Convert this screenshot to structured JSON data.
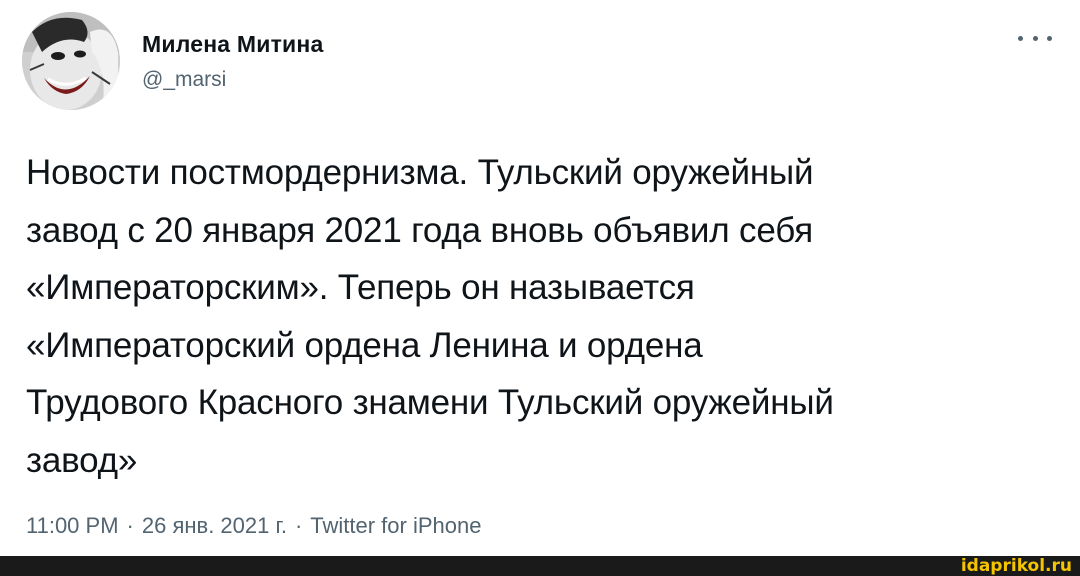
{
  "author": {
    "name": "Милена Митина",
    "handle": "@_marsi"
  },
  "tweet": {
    "text": "Новости постмордернизма. Тульский оружейный\nзавод с 20 января 2021 года вновь объявил себя\n«Императорским». Теперь он называется\n«Императорский ордена Ленина и ордена\nТрудового Красного знамени Тульский оружейный\nзавод»"
  },
  "meta": {
    "time": "11:00 PM",
    "separator": "·",
    "date": "26 янв. 2021 г.",
    "source": "Twitter for iPhone"
  },
  "watermark": {
    "text": "idaprikol.ru"
  },
  "icons": {
    "more": "more-dots-icon",
    "avatar": "avatar-image"
  },
  "colors": {
    "text_primary": "#0f1419",
    "text_secondary": "#536471",
    "watermark": "#f5c400",
    "footer_bar": "#1a1a1a"
  }
}
